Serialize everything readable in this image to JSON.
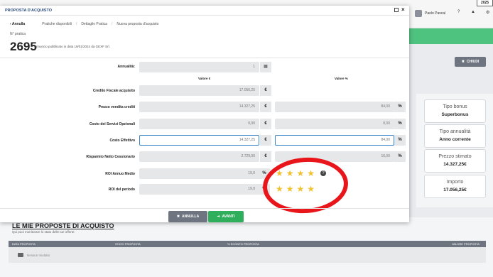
{
  "background": {
    "year": "2025",
    "user_name": "Paolo Pascal",
    "help_glyph": "?",
    "bell_glyph": "▲",
    "settings_glyph": "⚙",
    "chiudi_label": "CHIUDI",
    "cards": [
      {
        "label": "Tipo bonus",
        "value": "Superbonus"
      },
      {
        "label": "Tipo annualità",
        "value": "Anno corrente"
      },
      {
        "label": "Prezzo stimato",
        "value": "14.327,25€"
      },
      {
        "label": "Importo",
        "value": "17.056,25€"
      }
    ],
    "section_title": "LE MIE PROPOSTE DI ACQUISTO",
    "section_subtitle": "Qui puoi monitorare lo stato delle tue offerte.",
    "table_headers": [
      "DATA PROPOSTA",
      "STATO PROPOSTA",
      "% SCONTO PROPOSTA",
      "VALORE PROPOSTA"
    ],
    "no_results": "Nessun risultato"
  },
  "modal": {
    "title": "PROPOSTA D'ACQUISTO",
    "breadcrumb": {
      "back": "Annulla",
      "items": [
        "Pratiche disponibili",
        "Dettaglio Pratica",
        "Nuova proposta d'acquisto"
      ]
    },
    "pratica_label": "N° pratica",
    "pratica_number": "2695",
    "annuncio": "Annuncio pubblicato in data 19/01/2024 da GEXF Srl.",
    "annualita_label": "Annualità:",
    "annualita_value": "1",
    "col_valore_euro": "Valore €",
    "col_valore_pct": "Valore %",
    "rows": {
      "credito": {
        "label": "Credito Fiscale acquisito",
        "value": "17.056,25",
        "unit": "€"
      },
      "prezzo": {
        "label": "Prezzo vendita crediti",
        "value": "14.327,25",
        "unit": "€",
        "pct": "84,00",
        "pct_unit": "%"
      },
      "servizi": {
        "label": "Costo dei Servizi Opzionali",
        "value": "0,00",
        "unit": "€",
        "pct": "0,00",
        "pct_unit": "%"
      },
      "costo": {
        "label": "Costo Effettivo",
        "value": "14.327,25",
        "unit": "€",
        "pct": "84,00",
        "pct_unit": "%"
      },
      "risparmio": {
        "label": "Risparmio Netto Cessionario",
        "value": "2.729,00",
        "unit": "€",
        "pct": "16,00",
        "pct_unit": "%"
      },
      "roi_medio": {
        "label": "ROI Annuo Medio",
        "value": "19,0",
        "unit": "%"
      },
      "roi_periodo": {
        "label": "ROI del periodo",
        "value": "19,0",
        "unit": "%"
      }
    },
    "stars_glyph": "★",
    "help_glyph": "?",
    "buttons": {
      "annulla": "ANNULLA",
      "avanti": "AVANTI"
    }
  },
  "colors": {
    "green_bar": "#4ec27f",
    "avanti_button": "#2fae5c",
    "annulla_button": "#6e7580",
    "star": "#f2c12e",
    "annotation_circle": "#e8151b",
    "field_focus": "#3a86c8"
  }
}
